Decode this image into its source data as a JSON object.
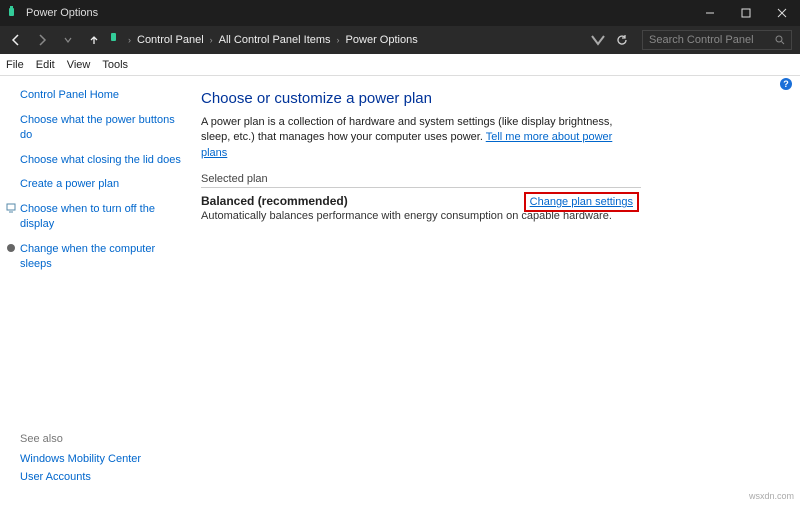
{
  "window": {
    "title": "Power Options"
  },
  "breadcrumb": {
    "root": "Control Panel",
    "mid": "All Control Panel Items",
    "leaf": "Power Options"
  },
  "search": {
    "placeholder": "Search Control Panel"
  },
  "menu": {
    "file": "File",
    "edit": "Edit",
    "view": "View",
    "tools": "Tools"
  },
  "sidebar": {
    "home": "Control Panel Home",
    "links": [
      "Choose what the power buttons do",
      "Choose what closing the lid does",
      "Create a power plan",
      "Choose when to turn off the display",
      "Change when the computer sleeps"
    ],
    "see_also": "See also",
    "see_links": [
      "Windows Mobility Center",
      "User Accounts"
    ]
  },
  "main": {
    "heading": "Choose or customize a power plan",
    "description_a": "A power plan is a collection of hardware and system settings (like display brightness, sleep, etc.) that manages how your computer uses power. ",
    "description_link": "Tell me more about power plans",
    "selected_label": "Selected plan",
    "plan_name": "Balanced (recommended)",
    "plan_desc": "Automatically balances performance with energy consumption on capable hardware.",
    "change_link": "Change plan settings"
  },
  "help": "?",
  "watermark": "wsxdn.com"
}
